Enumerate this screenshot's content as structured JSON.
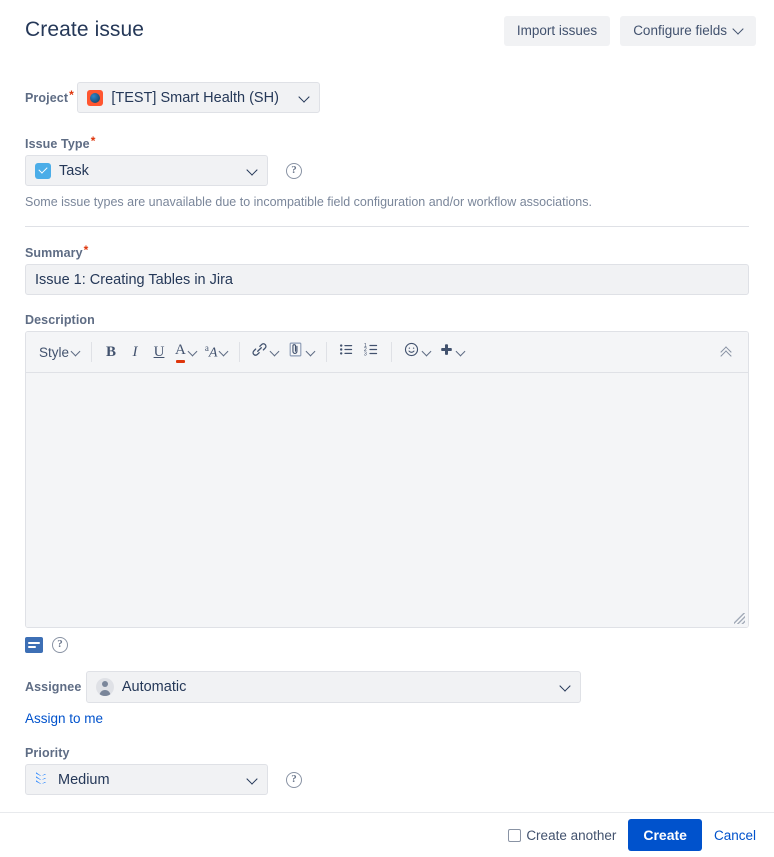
{
  "header": {
    "title": "Create issue",
    "import_label": "Import issues",
    "configure_label": "Configure fields"
  },
  "fields": {
    "project": {
      "label": "Project",
      "required": "*",
      "value": "[TEST] Smart Health (SH)",
      "icon": "project-avatar-icon"
    },
    "issue_type": {
      "label": "Issue Type",
      "required": "*",
      "value": "Task",
      "icon": "task-type-icon",
      "help": "?",
      "hint": "Some issue types are unavailable due to incompatible field configuration and/or workflow associations."
    },
    "summary": {
      "label": "Summary",
      "required": "*",
      "value": "Issue 1: Creating Tables in Jira",
      "placeholder": ""
    },
    "description": {
      "label": "Description",
      "value": "",
      "placeholder": ""
    },
    "assignee": {
      "label": "Assignee",
      "value": "Automatic",
      "icon": "avatar-icon",
      "assign_to_me": "Assign to me"
    },
    "priority": {
      "label": "Priority",
      "value": "Medium",
      "icon": "priority-medium-icon",
      "help": "?"
    }
  },
  "toolbar": {
    "style_label": "Style",
    "bold_label": "B",
    "italic_label": "I",
    "underline_label": "U",
    "text_color_label": "A",
    "text_effects_label": "A",
    "text_effects_sup": "a",
    "items": [
      {
        "name": "style-dropdown",
        "label": "Style"
      },
      {
        "name": "bold-button",
        "label": "B"
      },
      {
        "name": "italic-button",
        "label": "I"
      },
      {
        "name": "underline-button",
        "label": "U"
      },
      {
        "name": "text-color-dropdown",
        "label": "A"
      },
      {
        "name": "text-effects-dropdown",
        "label": "aA"
      },
      {
        "name": "link-dropdown",
        "label": "link"
      },
      {
        "name": "attachment-dropdown",
        "label": "attachment"
      },
      {
        "name": "bullet-list-button",
        "label": "bullet list"
      },
      {
        "name": "numbered-list-button",
        "label": "numbered list"
      },
      {
        "name": "emoji-dropdown",
        "label": "emoji"
      },
      {
        "name": "insert-more-dropdown",
        "label": "insert"
      },
      {
        "name": "collapse-toolbar-button",
        "label": "collapse"
      }
    ]
  },
  "editor_actions": {
    "mode_toggle": "visual-text-mode",
    "help": "?"
  },
  "footer": {
    "create_another_label": "Create another",
    "create_another_checked": false,
    "create_label": "Create",
    "cancel_label": "Cancel"
  },
  "colors": {
    "primary": "#0052cc",
    "link": "#0052cc",
    "required": "#de350b",
    "field_bg": "#f1f2f4",
    "border": "#dfe1e6",
    "text": "#253858",
    "muted": "#7a869a"
  }
}
